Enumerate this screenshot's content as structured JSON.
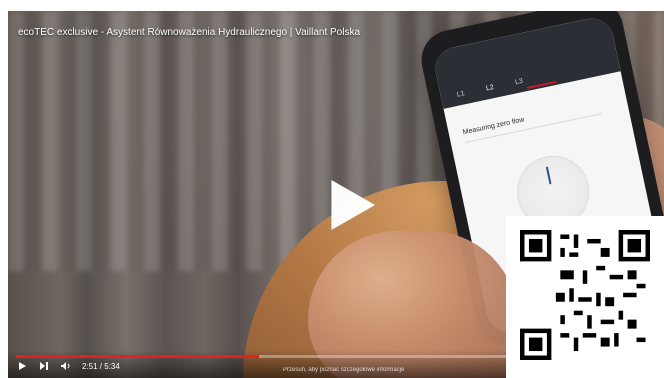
{
  "video": {
    "title": "ecoTEC exclusive - Asystent Równoważenia Hydraulicznego | Vaillant Polska",
    "progress_fraction": 0.38,
    "time_text": "2:51 / 5:34",
    "caption_text": "Przesuń, aby poznać szczegółowe informacje"
  },
  "phone_ui": {
    "tabs": [
      "L1",
      "L2",
      "L3"
    ],
    "screen_title": "Measuring zero flow",
    "value_text": "0%"
  },
  "qr": {
    "label": "qr-code"
  }
}
